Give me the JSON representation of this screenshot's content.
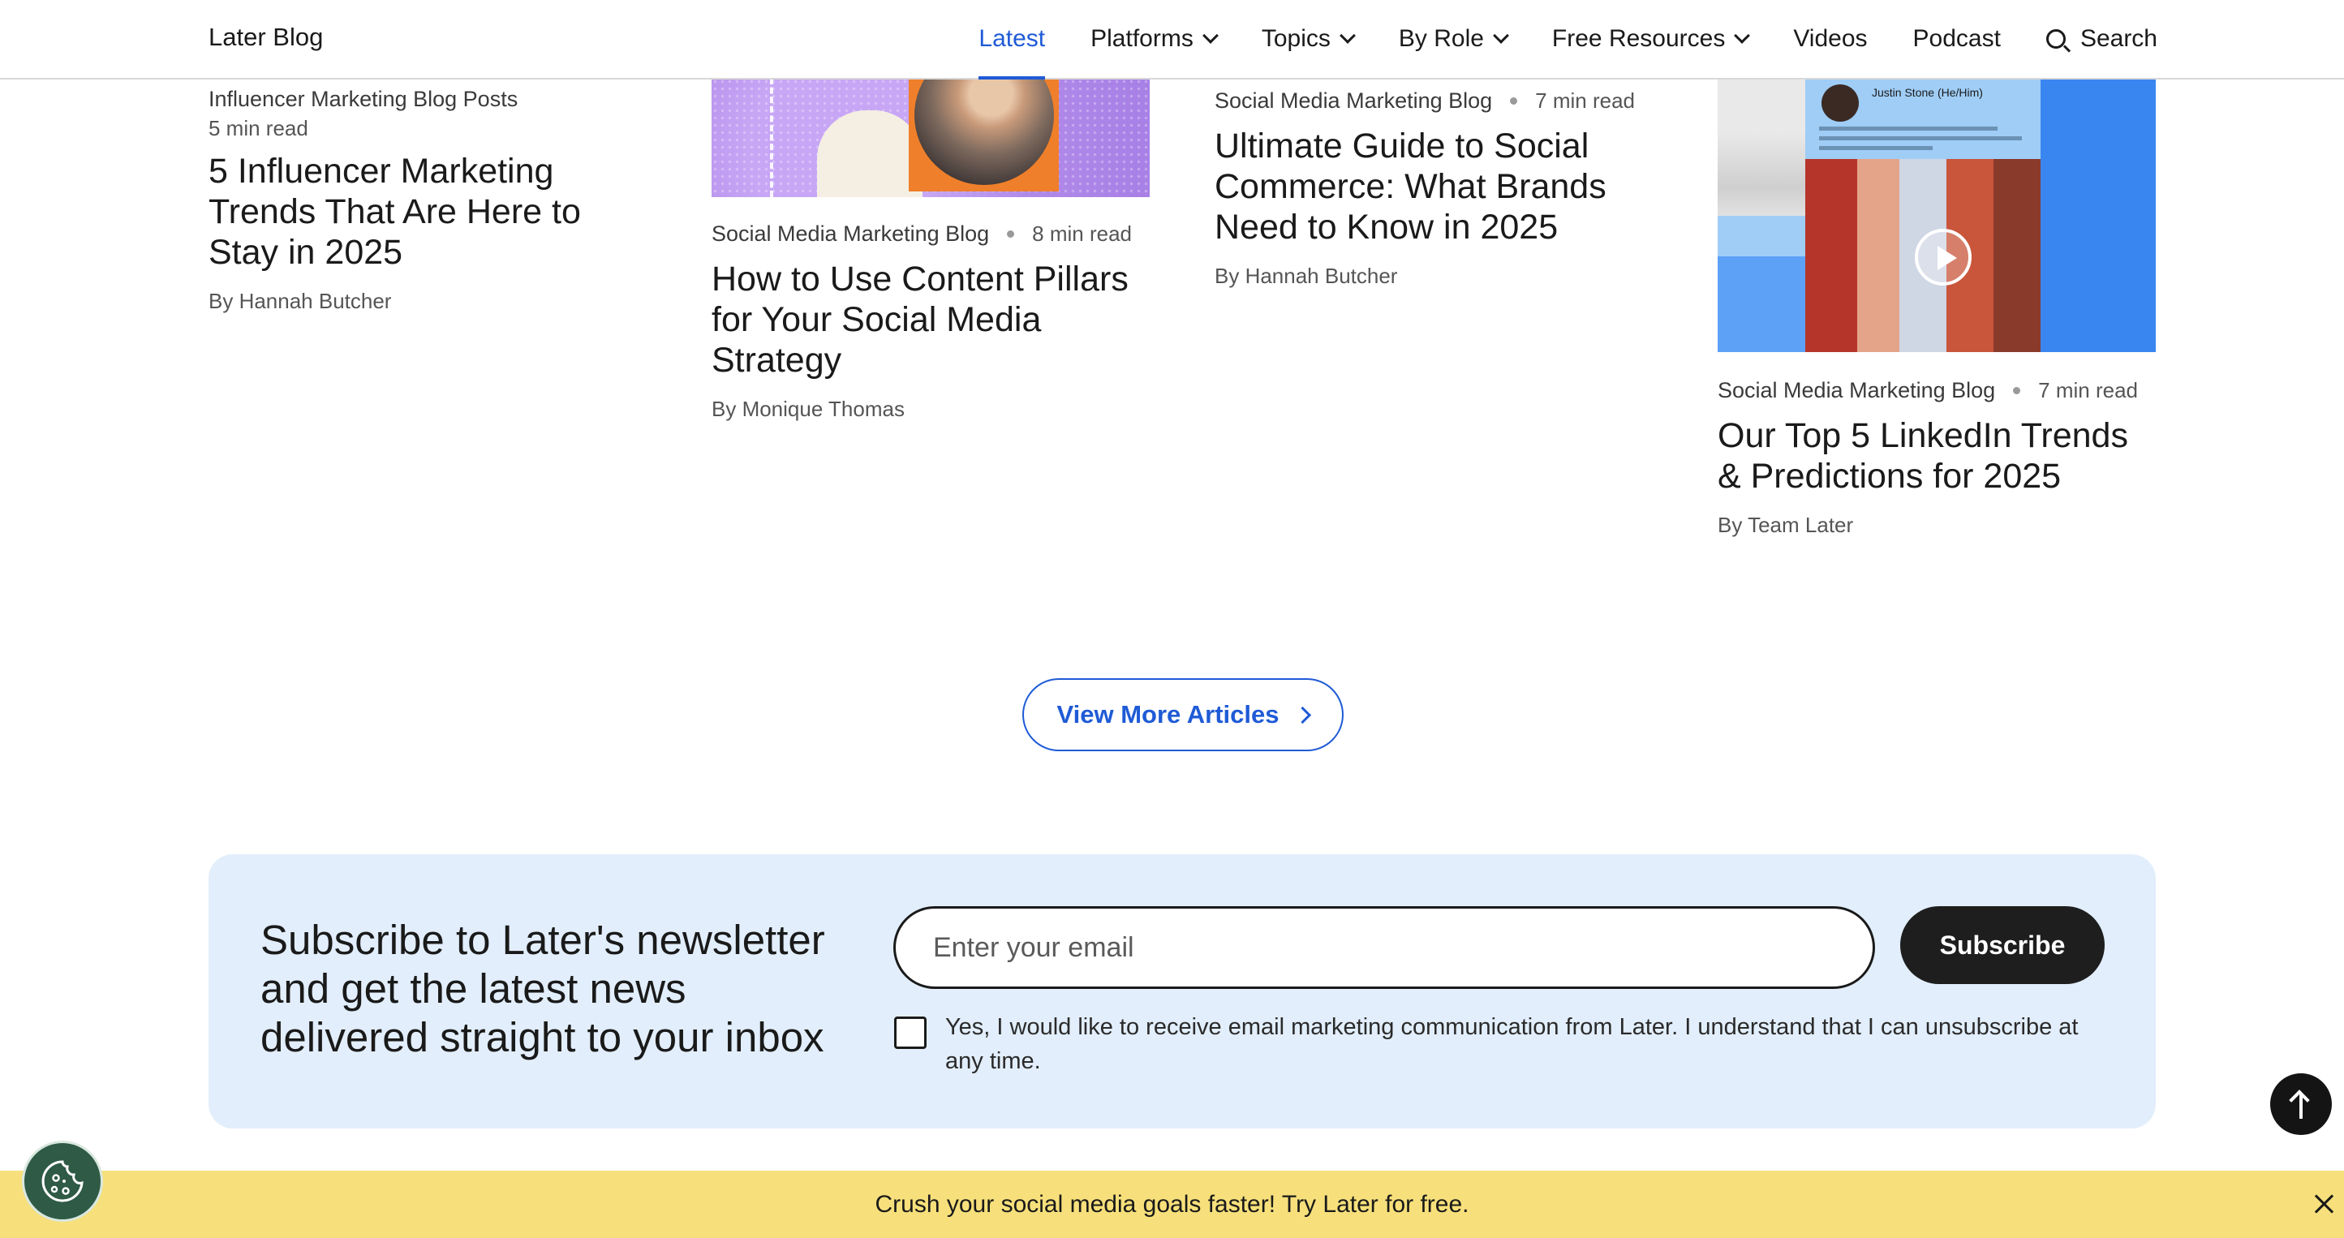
{
  "header": {
    "logo": "Later Blog",
    "nav": [
      {
        "label": "Latest",
        "active": true,
        "dropdown": false
      },
      {
        "label": "Platforms",
        "dropdown": true
      },
      {
        "label": "Topics",
        "dropdown": true
      },
      {
        "label": "By Role",
        "dropdown": true
      },
      {
        "label": "Free Resources",
        "dropdown": true
      },
      {
        "label": "Videos",
        "dropdown": false
      },
      {
        "label": "Podcast",
        "dropdown": false
      }
    ],
    "search_label": "Search",
    "accent_color": "#1f5bd6"
  },
  "articles": [
    {
      "category": "Influencer Marketing Blog Posts",
      "read_time": "5 min read",
      "title": "5 Influencer Marketing Trends That Are Here to Stay in 2025",
      "author": "By Hannah Butcher"
    },
    {
      "category": "Social Media Marketing Blog",
      "read_time": "8 min read",
      "title": "How to Use Content Pillars for Your Social Media Strategy",
      "author": "By Monique Thomas"
    },
    {
      "category": "Social Media Marketing Blog",
      "read_time": "7 min read",
      "title": "Ultimate Guide to Social Commerce: What Brands Need to Know in 2025",
      "author": "By Hannah Butcher"
    },
    {
      "category": "Social Media Marketing Blog",
      "read_time": "7 min read",
      "title": "Our Top 5 LinkedIn Trends & Predictions for 2025",
      "author": "By Team Later",
      "thumbnail_card_name": "Justin Stone (He/Him)"
    }
  ],
  "view_more_label": "View More Articles",
  "newsletter": {
    "heading": "Subscribe to Later's newsletter and get the latest news delivered straight to your inbox",
    "email_placeholder": "Enter your email",
    "email_value": "",
    "subscribe_label": "Subscribe",
    "consent_text": "Yes, I would like to receive email marketing communication from Later. I understand that I can unsubscribe at any time.",
    "consent_checked": false,
    "background": "#e2eefb"
  },
  "promo": {
    "text": "Crush your social media goals faster! Try Later for free.",
    "background": "#f7e07b"
  },
  "icons": {
    "back_to_top": "arrow-up-icon",
    "cookie": "cookie-icon",
    "close": "close-icon",
    "search": "search-icon"
  }
}
